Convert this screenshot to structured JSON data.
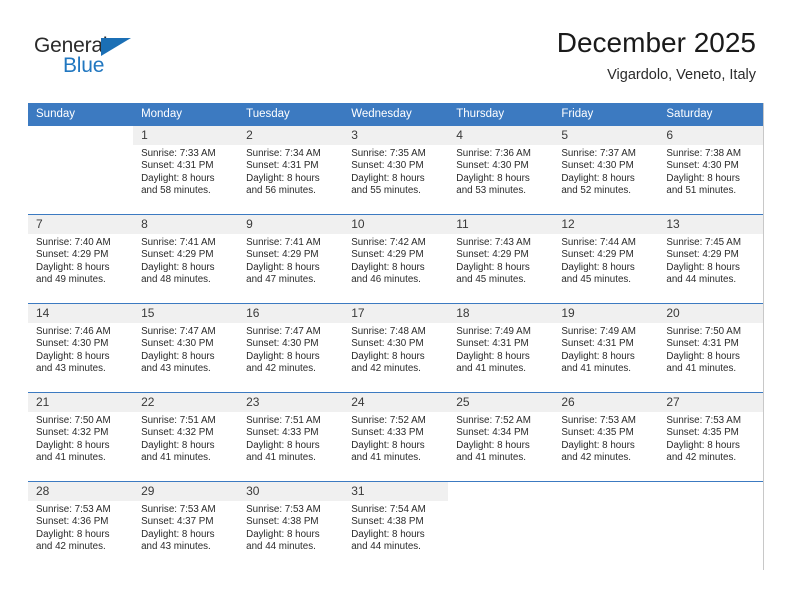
{
  "brand": {
    "name_part1": "General",
    "name_part2": "Blue",
    "flag_icon": "flag-icon"
  },
  "header": {
    "month_title": "December 2025",
    "location": "Vigardolo, Veneto, Italy"
  },
  "colors": {
    "header_blue": "#3c7ac1",
    "brand_blue": "#2177c0",
    "daynum_band": "#f0f0f0",
    "text": "#2a2a2a"
  },
  "weekdays": [
    "Sunday",
    "Monday",
    "Tuesday",
    "Wednesday",
    "Thursday",
    "Friday",
    "Saturday"
  ],
  "weeks": [
    [
      {
        "day": "",
        "blank": true,
        "lines": []
      },
      {
        "day": "1",
        "lines": [
          "Sunrise: 7:33 AM",
          "Sunset: 4:31 PM",
          "Daylight: 8 hours",
          "and 58 minutes."
        ]
      },
      {
        "day": "2",
        "lines": [
          "Sunrise: 7:34 AM",
          "Sunset: 4:31 PM",
          "Daylight: 8 hours",
          "and 56 minutes."
        ]
      },
      {
        "day": "3",
        "lines": [
          "Sunrise: 7:35 AM",
          "Sunset: 4:30 PM",
          "Daylight: 8 hours",
          "and 55 minutes."
        ]
      },
      {
        "day": "4",
        "lines": [
          "Sunrise: 7:36 AM",
          "Sunset: 4:30 PM",
          "Daylight: 8 hours",
          "and 53 minutes."
        ]
      },
      {
        "day": "5",
        "lines": [
          "Sunrise: 7:37 AM",
          "Sunset: 4:30 PM",
          "Daylight: 8 hours",
          "and 52 minutes."
        ]
      },
      {
        "day": "6",
        "lines": [
          "Sunrise: 7:38 AM",
          "Sunset: 4:30 PM",
          "Daylight: 8 hours",
          "and 51 minutes."
        ]
      }
    ],
    [
      {
        "day": "7",
        "lines": [
          "Sunrise: 7:40 AM",
          "Sunset: 4:29 PM",
          "Daylight: 8 hours",
          "and 49 minutes."
        ]
      },
      {
        "day": "8",
        "lines": [
          "Sunrise: 7:41 AM",
          "Sunset: 4:29 PM",
          "Daylight: 8 hours",
          "and 48 minutes."
        ]
      },
      {
        "day": "9",
        "lines": [
          "Sunrise: 7:41 AM",
          "Sunset: 4:29 PM",
          "Daylight: 8 hours",
          "and 47 minutes."
        ]
      },
      {
        "day": "10",
        "lines": [
          "Sunrise: 7:42 AM",
          "Sunset: 4:29 PM",
          "Daylight: 8 hours",
          "and 46 minutes."
        ]
      },
      {
        "day": "11",
        "lines": [
          "Sunrise: 7:43 AM",
          "Sunset: 4:29 PM",
          "Daylight: 8 hours",
          "and 45 minutes."
        ]
      },
      {
        "day": "12",
        "lines": [
          "Sunrise: 7:44 AM",
          "Sunset: 4:29 PM",
          "Daylight: 8 hours",
          "and 45 minutes."
        ]
      },
      {
        "day": "13",
        "lines": [
          "Sunrise: 7:45 AM",
          "Sunset: 4:29 PM",
          "Daylight: 8 hours",
          "and 44 minutes."
        ]
      }
    ],
    [
      {
        "day": "14",
        "lines": [
          "Sunrise: 7:46 AM",
          "Sunset: 4:30 PM",
          "Daylight: 8 hours",
          "and 43 minutes."
        ]
      },
      {
        "day": "15",
        "lines": [
          "Sunrise: 7:47 AM",
          "Sunset: 4:30 PM",
          "Daylight: 8 hours",
          "and 43 minutes."
        ]
      },
      {
        "day": "16",
        "lines": [
          "Sunrise: 7:47 AM",
          "Sunset: 4:30 PM",
          "Daylight: 8 hours",
          "and 42 minutes."
        ]
      },
      {
        "day": "17",
        "lines": [
          "Sunrise: 7:48 AM",
          "Sunset: 4:30 PM",
          "Daylight: 8 hours",
          "and 42 minutes."
        ]
      },
      {
        "day": "18",
        "lines": [
          "Sunrise: 7:49 AM",
          "Sunset: 4:31 PM",
          "Daylight: 8 hours",
          "and 41 minutes."
        ]
      },
      {
        "day": "19",
        "lines": [
          "Sunrise: 7:49 AM",
          "Sunset: 4:31 PM",
          "Daylight: 8 hours",
          "and 41 minutes."
        ]
      },
      {
        "day": "20",
        "lines": [
          "Sunrise: 7:50 AM",
          "Sunset: 4:31 PM",
          "Daylight: 8 hours",
          "and 41 minutes."
        ]
      }
    ],
    [
      {
        "day": "21",
        "lines": [
          "Sunrise: 7:50 AM",
          "Sunset: 4:32 PM",
          "Daylight: 8 hours",
          "and 41 minutes."
        ]
      },
      {
        "day": "22",
        "lines": [
          "Sunrise: 7:51 AM",
          "Sunset: 4:32 PM",
          "Daylight: 8 hours",
          "and 41 minutes."
        ]
      },
      {
        "day": "23",
        "lines": [
          "Sunrise: 7:51 AM",
          "Sunset: 4:33 PM",
          "Daylight: 8 hours",
          "and 41 minutes."
        ]
      },
      {
        "day": "24",
        "lines": [
          "Sunrise: 7:52 AM",
          "Sunset: 4:33 PM",
          "Daylight: 8 hours",
          "and 41 minutes."
        ]
      },
      {
        "day": "25",
        "lines": [
          "Sunrise: 7:52 AM",
          "Sunset: 4:34 PM",
          "Daylight: 8 hours",
          "and 41 minutes."
        ]
      },
      {
        "day": "26",
        "lines": [
          "Sunrise: 7:53 AM",
          "Sunset: 4:35 PM",
          "Daylight: 8 hours",
          "and 42 minutes."
        ]
      },
      {
        "day": "27",
        "lines": [
          "Sunrise: 7:53 AM",
          "Sunset: 4:35 PM",
          "Daylight: 8 hours",
          "and 42 minutes."
        ]
      }
    ],
    [
      {
        "day": "28",
        "lines": [
          "Sunrise: 7:53 AM",
          "Sunset: 4:36 PM",
          "Daylight: 8 hours",
          "and 42 minutes."
        ]
      },
      {
        "day": "29",
        "lines": [
          "Sunrise: 7:53 AM",
          "Sunset: 4:37 PM",
          "Daylight: 8 hours",
          "and 43 minutes."
        ]
      },
      {
        "day": "30",
        "lines": [
          "Sunrise: 7:53 AM",
          "Sunset: 4:38 PM",
          "Daylight: 8 hours",
          "and 44 minutes."
        ]
      },
      {
        "day": "31",
        "lines": [
          "Sunrise: 7:54 AM",
          "Sunset: 4:38 PM",
          "Daylight: 8 hours",
          "and 44 minutes."
        ]
      },
      {
        "day": "",
        "blank": true,
        "lines": []
      },
      {
        "day": "",
        "blank": true,
        "lines": []
      },
      {
        "day": "",
        "blank": true,
        "lines": []
      }
    ]
  ]
}
